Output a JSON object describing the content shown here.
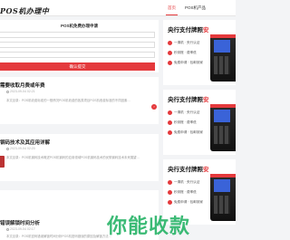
{
  "header": {
    "logo_text": "POS机办理中心",
    "nav": [
      "首页",
      "POS机产品"
    ]
  },
  "form": {
    "title": "POS机免费办理申请",
    "name_placeholder": "",
    "phone_placeholder": "",
    "address_placeholder": "",
    "submit_label": "确认提交"
  },
  "articles": [
    {
      "title": "需要收取月费或年费",
      "date": "2023-09-04 02:21",
      "desc": "本文目录：POS机收费标准的一般情况POS机收费的各类项目POS机收费标准的不同因素…"
    },
    {
      "title": "钢码技术及其应用详解",
      "date": "2023-09-04 02:20",
      "desc": "本文目录：POS机钢码技术概述POS机钢码的应用领域POS机钢码技术的优势钢码技术未来展望…"
    },
    {
      "title": "错误解锁时间分析",
      "date": "2023-09-04 02:17",
      "desc": "本文目录：POS机密码错误解锁时间分析POS机密码错误的原因及解锁方法…"
    }
  ],
  "sidebar": {
    "ads": [
      {
        "title_a": "央行支付牌照",
        "title_b": "安",
        "rows": [
          "一清机 · 央行认证",
          "秒到账 · 费率低",
          "免费申请 · 包邮到家"
        ]
      },
      {
        "title_a": "央行支付牌照",
        "title_b": "安",
        "rows": [
          "一清机 · 央行认证",
          "秒到账 · 费率低",
          "免费申请 · 包邮到家"
        ]
      },
      {
        "title_a": "央行支付牌照",
        "title_b": "安",
        "rows": [
          "一清机 · 央行认证",
          "秒到账 · 费率低",
          "免费申请 · 包邮到家"
        ]
      }
    ]
  },
  "watermark": "你能收款",
  "colors": {
    "accent": "#e4393c",
    "watermark": "#2bb56a"
  }
}
